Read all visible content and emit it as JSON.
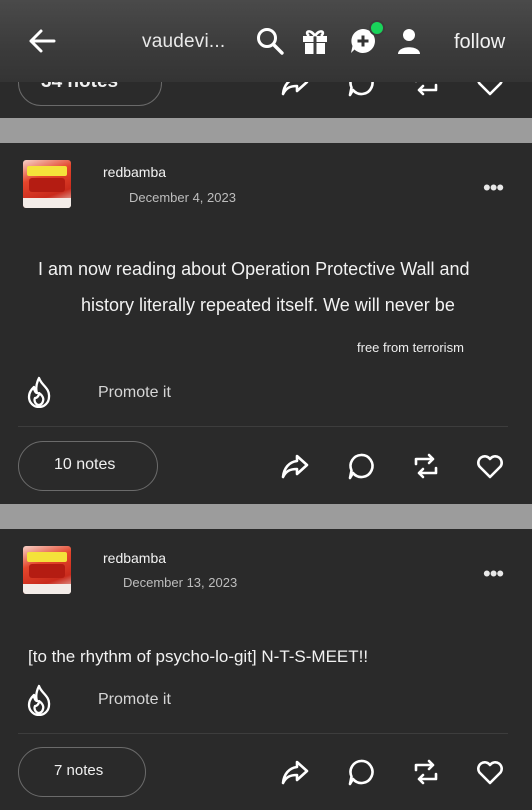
{
  "header": {
    "blog_title": "vaudevi...",
    "follow_label": "follow",
    "icons": [
      "back-arrow-icon",
      "search-icon",
      "gift-icon",
      "chat-add-icon",
      "user-icon"
    ],
    "notification_dot_color": "#19d35a"
  },
  "previous_post": {
    "notes_label": "34 notes"
  },
  "posts": [
    {
      "username": "redbamba",
      "date": "December 4, 2023",
      "body_lines": [
        "I am now reading about Operation Protective Wall and",
        "history literally repeated itself. We will never be"
      ],
      "small_line": "free from terrorism",
      "promote_label": "Promote it",
      "notes_label": "10 notes",
      "more_label": "•••"
    },
    {
      "username": "redbamba",
      "date": "December 13, 2023",
      "body_lines": [
        "[to the rhythm of psycho-lo-git] N-T-S-MEET!!"
      ],
      "promote_label": "Promote it",
      "notes_label": "7 notes",
      "more_label": "•••"
    }
  ],
  "colors": {
    "background": "#2a2a2a",
    "separator": "#9c9c9c",
    "text": "#f2f2f2"
  }
}
